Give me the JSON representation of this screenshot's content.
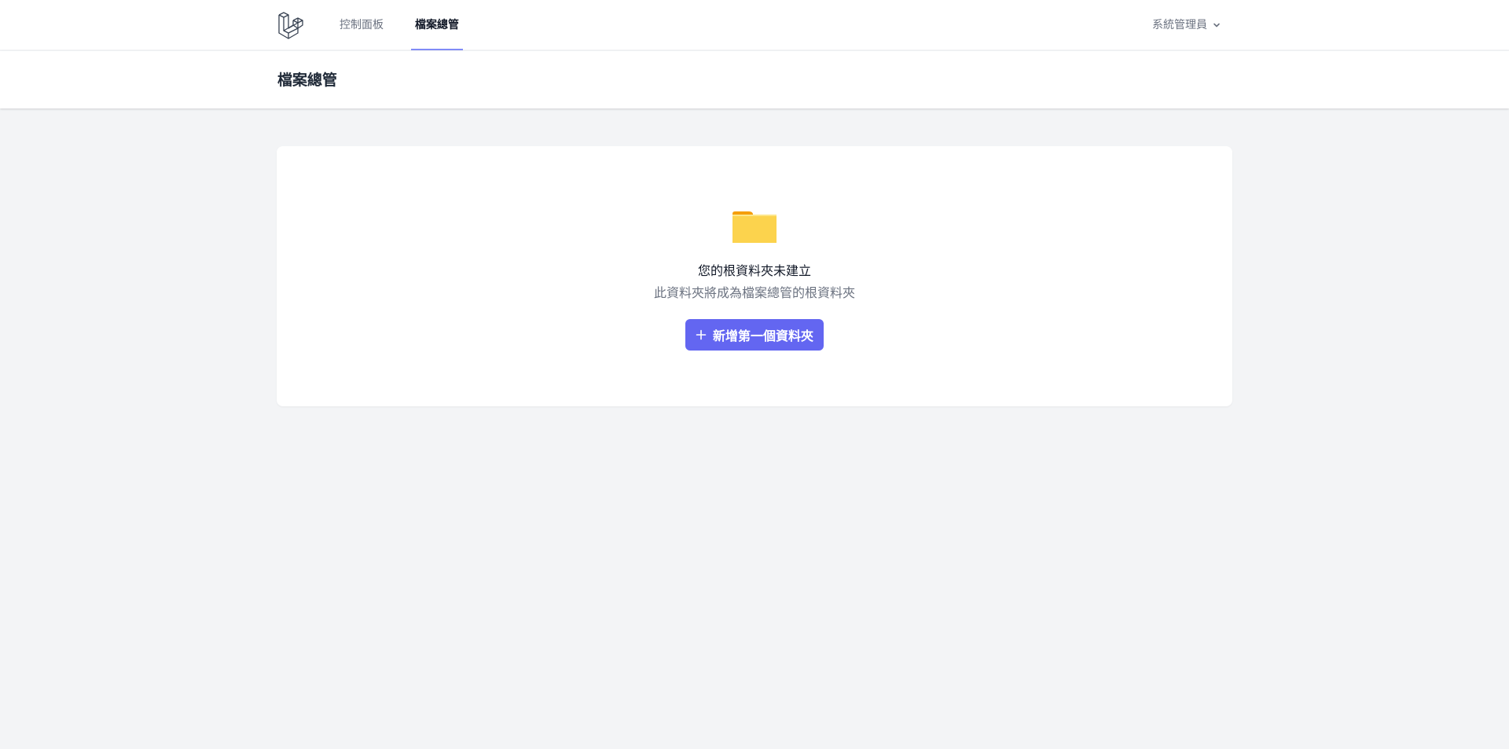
{
  "nav": {
    "logo_icon": "laravel-logo-icon",
    "items": [
      {
        "label": "控制面板",
        "active": false
      },
      {
        "label": "檔案總管",
        "active": true
      }
    ],
    "user": {
      "name": "系統管理員",
      "dropdown_icon": "chevron-down-icon"
    }
  },
  "header": {
    "title": "檔案總管"
  },
  "empty_state": {
    "icon": "folder-icon",
    "title": "您的根資料夾未建立",
    "subtitle": "此資料夾將成為檔案總管的根資料夾",
    "button_label": "新增第一個資料夾",
    "button_icon": "plus-icon"
  },
  "colors": {
    "accent": "#6366f1",
    "active_underline": "#818cf8",
    "folder": "#fcd34d",
    "background": "#f3f4f6"
  }
}
